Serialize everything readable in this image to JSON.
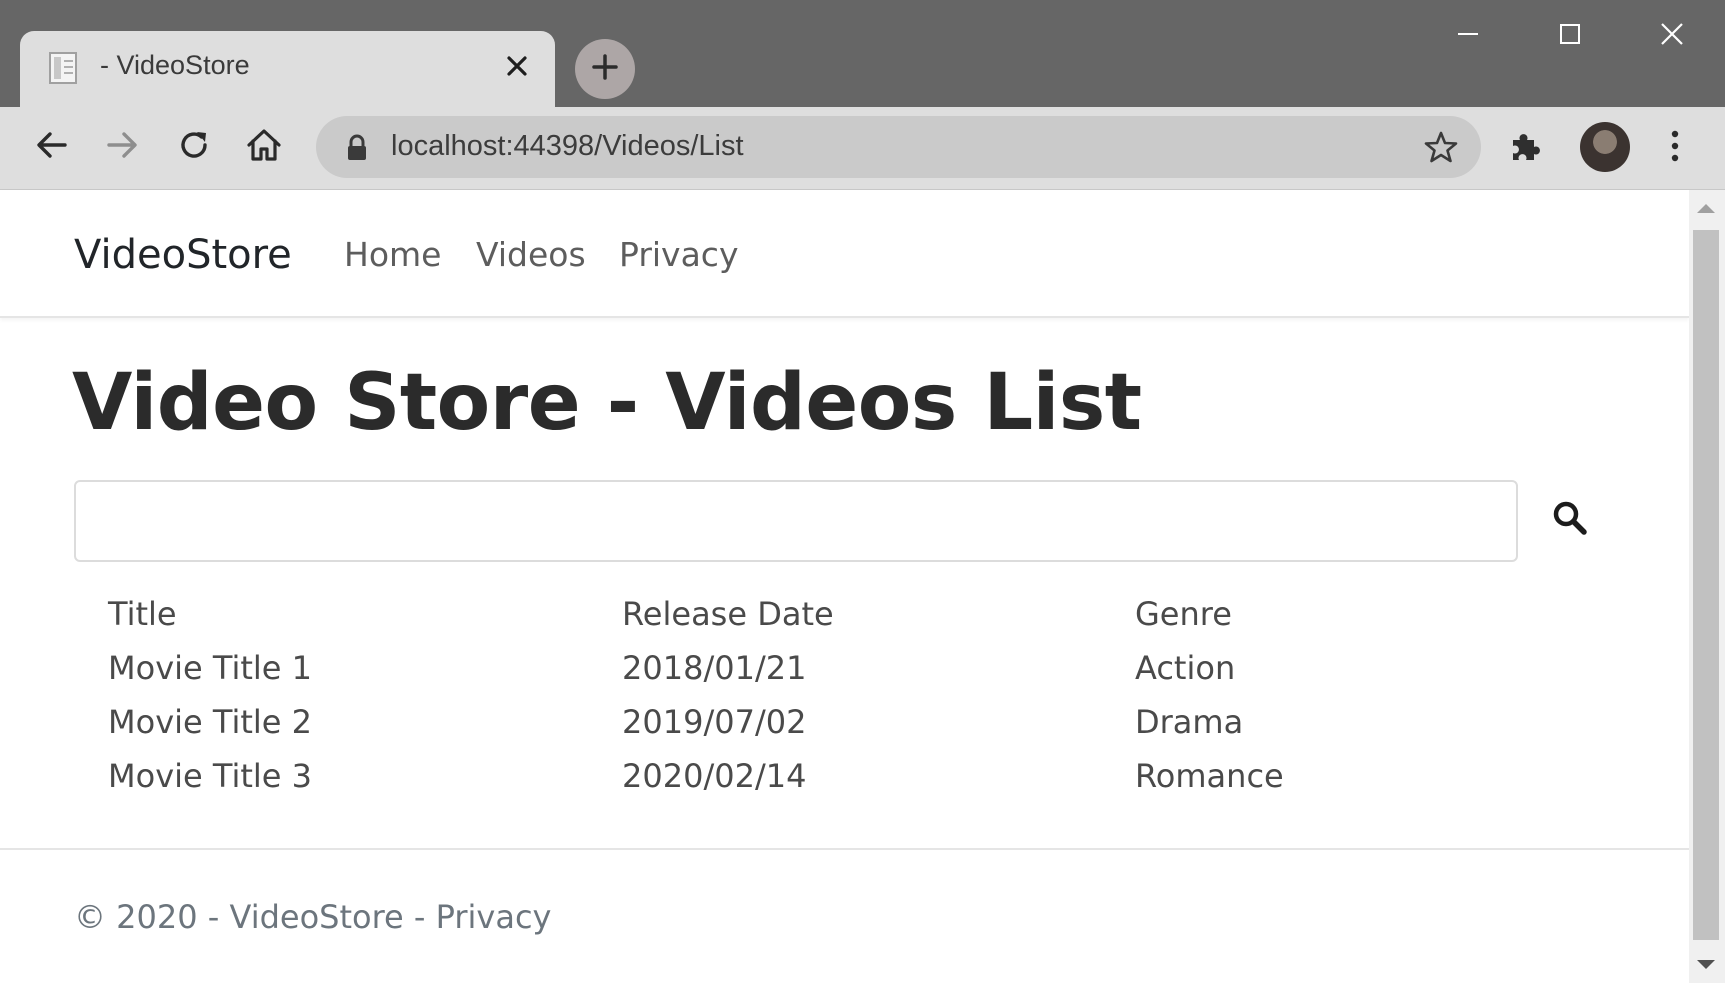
{
  "browser": {
    "tab_title": " - VideoStore",
    "url": "localhost:44398/Videos/List",
    "icons": {
      "favicon": "document-icon",
      "tab_close": "close-icon",
      "new_tab": "plus-icon",
      "minimize": "minimize-icon",
      "maximize": "maximize-icon",
      "close_window": "close-icon",
      "back": "arrow-left-icon",
      "forward": "arrow-right-icon",
      "reload": "reload-icon",
      "home": "home-icon",
      "lock": "lock-icon",
      "bookmark": "star-icon",
      "extensions": "puzzle-icon",
      "profile": "avatar",
      "menu": "kebab-menu-icon"
    }
  },
  "nav": {
    "brand": "VideoStore",
    "links": [
      "Home",
      "Videos",
      "Privacy"
    ]
  },
  "main": {
    "title": "Video Store - Videos List",
    "search": {
      "value": "",
      "placeholder": ""
    },
    "table": {
      "headers": [
        "Title",
        "Release Date",
        "Genre"
      ],
      "rows": [
        [
          "Movie Title 1",
          "2018/01/21",
          "Action"
        ],
        [
          "Movie Title 2",
          "2019/07/02",
          "Drama"
        ],
        [
          "Movie Title 3",
          "2020/02/14",
          "Romance"
        ]
      ]
    }
  },
  "footer": {
    "text": "© 2020 - VideoStore - ",
    "link": "Privacy"
  },
  "colors": {
    "titlebar": "#666666",
    "toolbar": "#dedede",
    "omnibox": "#cacaca",
    "text": "#212529",
    "muted": "#6c757d"
  }
}
